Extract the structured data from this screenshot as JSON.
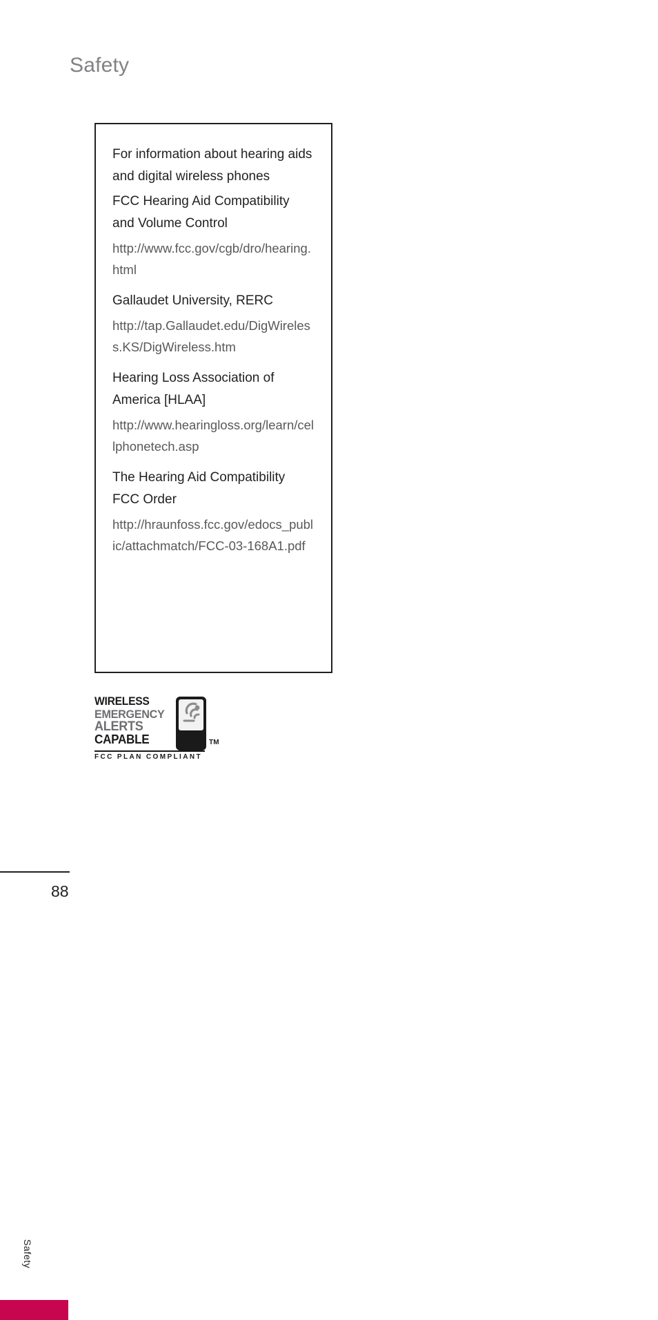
{
  "page": {
    "title": "Safety",
    "number": "88"
  },
  "side_tab": {
    "label": "Safety",
    "chip_color": "#c8054f"
  },
  "info_box": {
    "blocks": [
      {
        "heading": "For information about hearing aids and digital wireless phones",
        "url": ""
      },
      {
        "heading": "FCC Hearing Aid Compatibility and Volume Control",
        "url": "http://www.fcc.gov/cgb/dro/hearing.html"
      },
      {
        "heading": "Gallaudet University, RERC",
        "url": "http://tap.Gallaudet.edu/DigWireless.KS/DigWireless.htm"
      },
      {
        "heading": "Hearing Loss Association of America [HLAA]",
        "url": "http://www.hearingloss.org/learn/cellphonetech.asp"
      },
      {
        "heading": "The Hearing Aid Compatibility FCC Order",
        "url": "http://hraunfoss.fcc.gov/edocs_public/attachmatch/FCC-03-168A1.pdf"
      }
    ]
  },
  "wea_logo": {
    "line1": "WIRELESS",
    "line2": "EMERGENCY",
    "line3": "ALERTS",
    "line4": "CAPABLE",
    "trademark": "TM",
    "compliance": "FCC PLAN COMPLIANT"
  }
}
